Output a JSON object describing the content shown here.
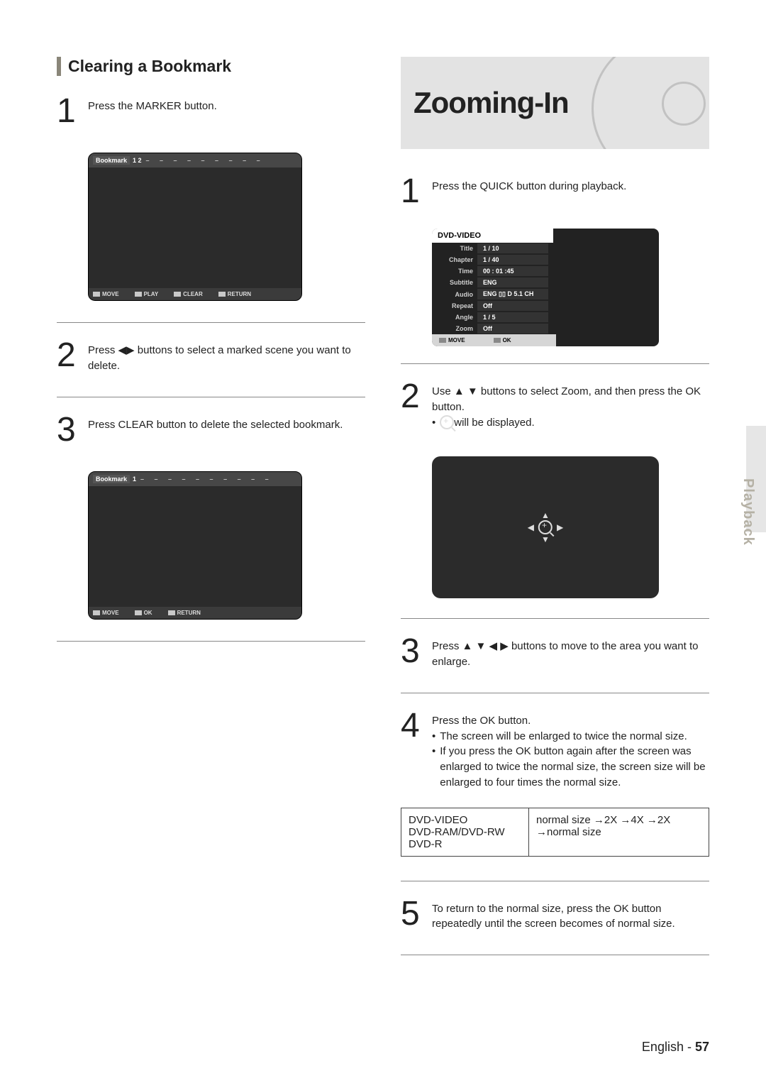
{
  "left": {
    "section_title": "Clearing a Bookmark",
    "step1": {
      "num": "1",
      "text": "Press the MARKER button.",
      "osd": {
        "label": "Bookmark",
        "slots": "1 2",
        "dashes": "– – – – – – – – –",
        "hints": [
          "MOVE",
          "PLAY",
          "CLEAR",
          "RETURN"
        ]
      }
    },
    "step2": {
      "num": "2",
      "text_before": "Press ",
      "text_after": " buttons to select a marked scene you want to delete."
    },
    "step3": {
      "num": "3",
      "text": "Press CLEAR button to delete the selected bookmark.",
      "osd": {
        "label": "Bookmark",
        "slots": "1",
        "dashes": "– – – – – – – – – –",
        "hints": [
          "MOVE",
          "OK",
          "RETURN"
        ]
      }
    }
  },
  "right": {
    "banner_title": "Zooming-In",
    "step1": {
      "num": "1",
      "text": "Press the QUICK button during playback.",
      "panel": {
        "title": "DVD-VIDEO",
        "rows": [
          {
            "label": "Title",
            "value": "1 / 10"
          },
          {
            "label": "Chapter",
            "value": "1 / 40"
          },
          {
            "label": "Time",
            "value": "00 : 01 :45"
          },
          {
            "label": "Subtitle",
            "value": "ENG"
          },
          {
            "label": "Audio",
            "value": "ENG ▯▯ D 5.1 CH"
          },
          {
            "label": "Repeat",
            "value": "Off"
          },
          {
            "label": "Angle",
            "value": "1 / 5"
          },
          {
            "label": "Zoom",
            "value": "Off"
          }
        ],
        "hints": [
          "MOVE",
          "OK"
        ]
      }
    },
    "step2": {
      "num": "2",
      "line1_before": "Use ",
      "line1_after": " buttons to select Zoom, and then press the OK button.",
      "bullet": " will be displayed."
    },
    "step3": {
      "num": "3",
      "before": "Press ",
      "after": " buttons to move to the area you want to enlarge."
    },
    "step4": {
      "num": "4",
      "line1": "Press the OK button.",
      "b1": "The screen will be enlarged to twice the normal size.",
      "b2": "If you press the OK button again after the screen was enlarged to twice the normal size, the screen size will be enlarged to four times the normal size."
    },
    "ztable": {
      "left1": "DVD-VIDEO",
      "left2": "DVD-RAM/DVD-RW",
      "left3": "DVD-R",
      "right": "normal size →2X →4X →2X →normal size"
    },
    "step5": {
      "num": "5",
      "text": "To return to the normal size, press the OK button repeatedly until the screen becomes of normal size."
    }
  },
  "sidetab": "Playback",
  "footer_lang": "English - ",
  "footer_page": "57"
}
